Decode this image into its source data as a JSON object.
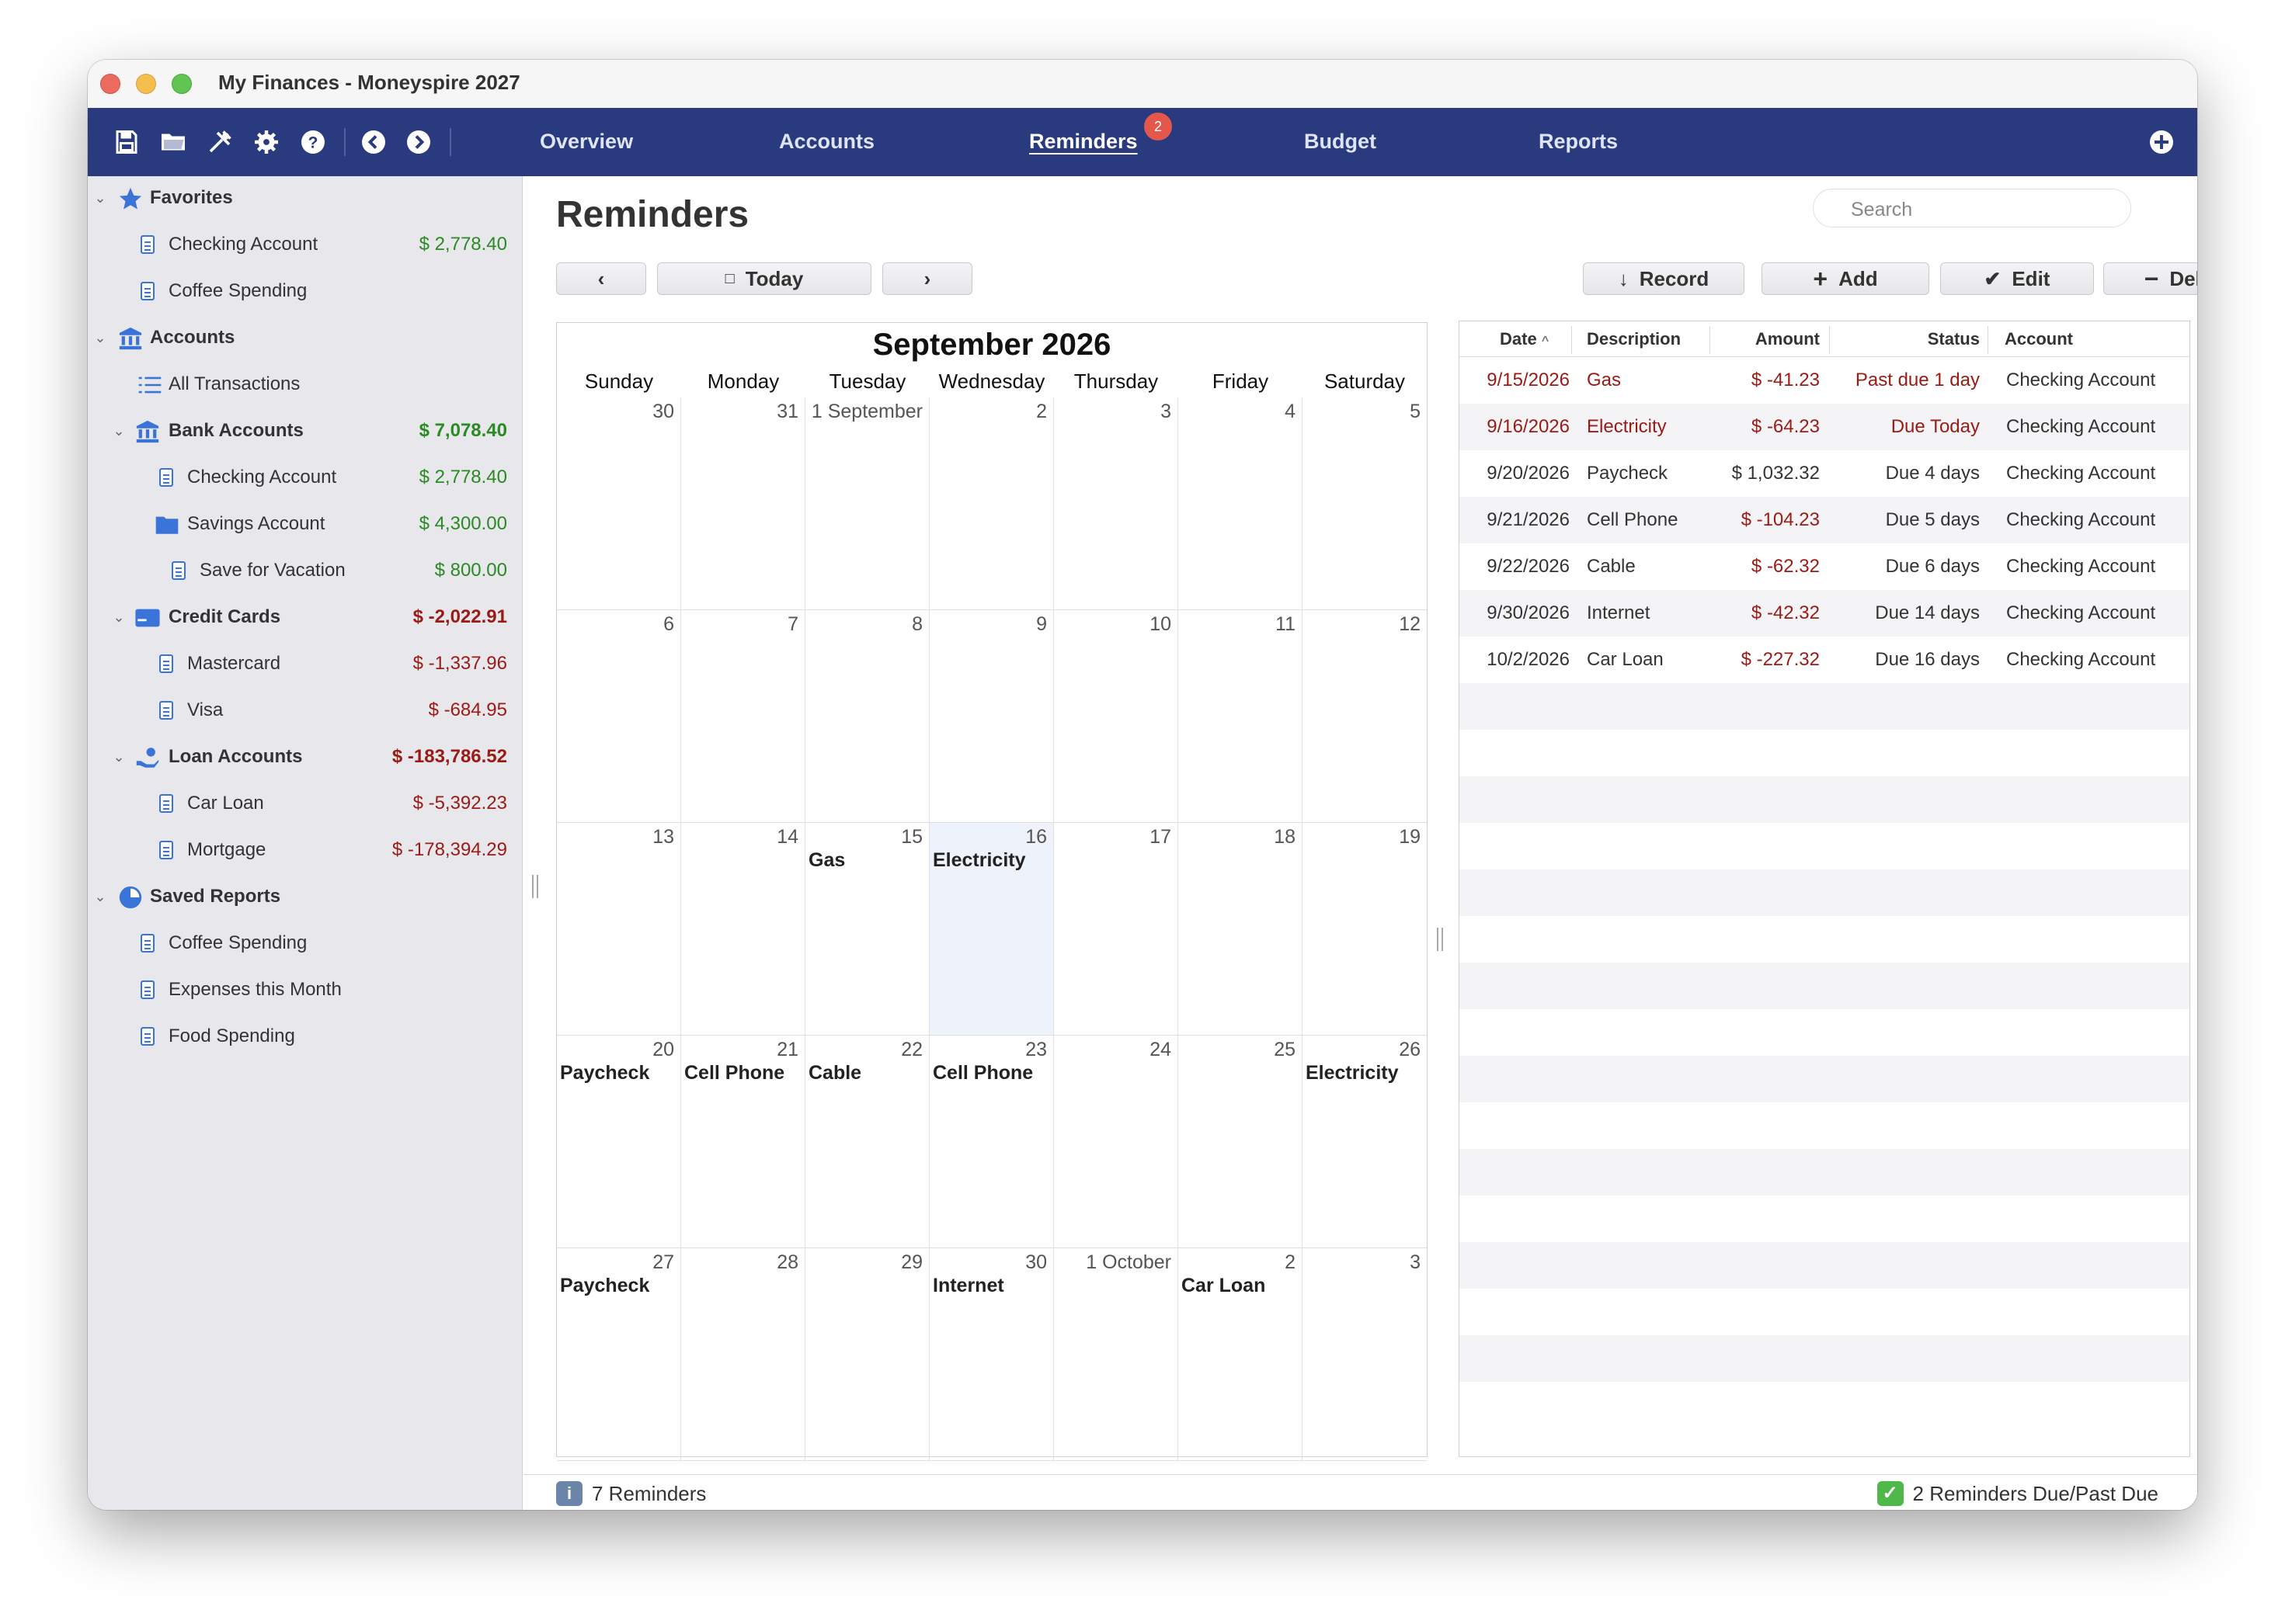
{
  "window": {
    "title": "My Finances - Moneyspire 2027"
  },
  "toolbar": {
    "icons": [
      "save-icon",
      "folder-icon",
      "tools-icon",
      "gear-icon",
      "help-icon",
      "back-icon",
      "forward-icon"
    ],
    "tabs": [
      {
        "label": "Overview"
      },
      {
        "label": "Accounts"
      },
      {
        "label": "Reminders",
        "badge": "2",
        "active": true
      },
      {
        "label": "Budget"
      },
      {
        "label": "Reports"
      }
    ],
    "add_icon": "plus-circle-icon"
  },
  "sidebar": {
    "favorites": {
      "label": "Favorites",
      "items": [
        {
          "label": "Checking Account",
          "amount": "$ 2,778.40"
        },
        {
          "label": "Coffee Spending",
          "amount": ""
        }
      ]
    },
    "accounts": {
      "label": "Accounts",
      "all_transactions": "All Transactions",
      "bank": {
        "label": "Bank Accounts",
        "amount": "$ 7,078.40",
        "items": [
          {
            "label": "Checking Account",
            "amount": "$ 2,778.40"
          },
          {
            "label": "Savings Account",
            "amount": "$ 4,300.00"
          },
          {
            "label": "Save for Vacation",
            "amount": "$ 800.00"
          }
        ]
      },
      "credit": {
        "label": "Credit Cards",
        "amount": "$ -2,022.91",
        "items": [
          {
            "label": "Mastercard",
            "amount": "$ -1,337.96"
          },
          {
            "label": "Visa",
            "amount": "$ -684.95"
          }
        ]
      },
      "loan": {
        "label": "Loan Accounts",
        "amount": "$ -183,786.52",
        "items": [
          {
            "label": "Car Loan",
            "amount": "$ -5,392.23"
          },
          {
            "label": "Mortgage",
            "amount": "$ -178,394.29"
          }
        ]
      }
    },
    "saved_reports": {
      "label": "Saved Reports",
      "items": [
        {
          "label": "Coffee Spending"
        },
        {
          "label": "Expenses this Month"
        },
        {
          "label": "Food Spending"
        }
      ]
    }
  },
  "main": {
    "title": "Reminders",
    "search_placeholder": "Search",
    "nav": {
      "prev": "‹",
      "today": "Today",
      "next": "›"
    },
    "actions": {
      "record": "Record",
      "add": "Add",
      "edit": "Edit",
      "delete": "Delete"
    }
  },
  "calendar": {
    "month_title": "September 2026",
    "weekdays": [
      "Sunday",
      "Monday",
      "Tuesday",
      "Wednesday",
      "Thursday",
      "Friday",
      "Saturday"
    ],
    "weeks": [
      [
        {
          "d": "30"
        },
        {
          "d": "31"
        },
        {
          "d": "1 September"
        },
        {
          "d": "2"
        },
        {
          "d": "3"
        },
        {
          "d": "4"
        },
        {
          "d": "5"
        }
      ],
      [
        {
          "d": "6"
        },
        {
          "d": "7"
        },
        {
          "d": "8"
        },
        {
          "d": "9"
        },
        {
          "d": "10"
        },
        {
          "d": "11"
        },
        {
          "d": "12"
        }
      ],
      [
        {
          "d": "13"
        },
        {
          "d": "14"
        },
        {
          "d": "15",
          "e": "Gas"
        },
        {
          "d": "16",
          "e": "Electricity",
          "today": true
        },
        {
          "d": "17"
        },
        {
          "d": "18"
        },
        {
          "d": "19"
        }
      ],
      [
        {
          "d": "20",
          "e": "Paycheck"
        },
        {
          "d": "21",
          "e": "Cell Phone"
        },
        {
          "d": "22",
          "e": "Cable"
        },
        {
          "d": "23",
          "e": "Cell Phone"
        },
        {
          "d": "24"
        },
        {
          "d": "25"
        },
        {
          "d": "26",
          "e": "Electricity"
        }
      ],
      [
        {
          "d": "27",
          "e": "Paycheck"
        },
        {
          "d": "28"
        },
        {
          "d": "29"
        },
        {
          "d": "30",
          "e": "Internet"
        },
        {
          "d": "1 October"
        },
        {
          "d": "2",
          "e": "Car Loan"
        },
        {
          "d": "3"
        }
      ]
    ]
  },
  "reminders": {
    "columns": [
      "Date",
      "Description",
      "Amount",
      "Status",
      "Account"
    ],
    "rows": [
      {
        "date": "9/15/2026",
        "desc": "Gas",
        "amount": "$ -41.23",
        "status": "Past due 1 day",
        "account": "Checking Account",
        "overdue": true
      },
      {
        "date": "9/16/2026",
        "desc": "Electricity",
        "amount": "$ -64.23",
        "status": "Due Today",
        "account": "Checking Account",
        "overdue": true
      },
      {
        "date": "9/20/2026",
        "desc": "Paycheck",
        "amount": "$ 1,032.32",
        "status": "Due 4 days",
        "account": "Checking Account"
      },
      {
        "date": "9/21/2026",
        "desc": "Cell Phone",
        "amount": "$ -104.23",
        "status": "Due 5 days",
        "account": "Checking Account"
      },
      {
        "date": "9/22/2026",
        "desc": "Cable",
        "amount": "$ -62.32",
        "status": "Due 6 days",
        "account": "Checking Account"
      },
      {
        "date": "9/30/2026",
        "desc": "Internet",
        "amount": "$ -42.32",
        "status": "Due 14 days",
        "account": "Checking Account"
      },
      {
        "date": "10/2/2026",
        "desc": "Car Loan",
        "amount": "$ -227.32",
        "status": "Due 16 days",
        "account": "Checking Account"
      }
    ]
  },
  "statusbar": {
    "left": "7 Reminders",
    "right": "2 Reminders Due/Past Due"
  },
  "colors": {
    "toolbar": "#2a3a7e",
    "positive": "#2a8a24",
    "negative": "#9b1a15",
    "badge": "#e3584a"
  }
}
